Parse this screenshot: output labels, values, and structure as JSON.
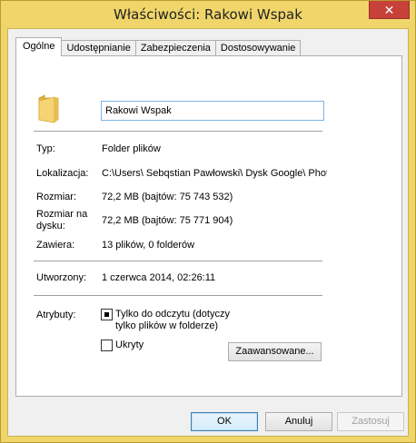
{
  "window": {
    "title": "Właściwości: Rakowi Wspak",
    "close_label": "✕"
  },
  "tabs": [
    {
      "label": "Ogólne",
      "active": true
    },
    {
      "label": "Udostępnianie",
      "active": false
    },
    {
      "label": "Zabezpieczenia",
      "active": false
    },
    {
      "label": "Dostosowywanie",
      "active": false
    }
  ],
  "general": {
    "folder_name": "Rakowi Wspak",
    "type_label": "Typ:",
    "type_value": "Folder plików",
    "location_label": "Lokalizacja:",
    "location_value": "C:\\Users\\ Sebqstian Pawłowski\\ Dysk Google\\ Photo",
    "size_label": "Rozmiar:",
    "size_value": "72,2 MB (bajtów: 75 743 532)",
    "size_on_disk_label_1": "Rozmiar na",
    "size_on_disk_label_2": "dysku:",
    "size_on_disk_value": "72,2 MB (bajtów: 75 771 904)",
    "contains_label": "Zawiera:",
    "contains_value": "13 plików, 0 folderów",
    "created_label": "Utworzony:",
    "created_value": "1 czerwca 2014, 02:26:11",
    "attributes_label": "Atrybuty:",
    "readonly_label_1": "Tylko do odczytu (dotyczy",
    "readonly_label_2": "tylko plików w folderze)",
    "readonly_state": "indeterminate",
    "hidden_label": "Ukryty",
    "hidden_checked": false,
    "advanced_button": "Zaawansowane..."
  },
  "footer": {
    "ok": "OK",
    "cancel": "Anuluj",
    "apply": "Zastosuj"
  },
  "colors": {
    "frame": "#f0d66a",
    "close": "#c7413b",
    "folder": "#f2c75c"
  },
  "icons": {
    "folder": "folder-icon",
    "close": "close-icon"
  }
}
